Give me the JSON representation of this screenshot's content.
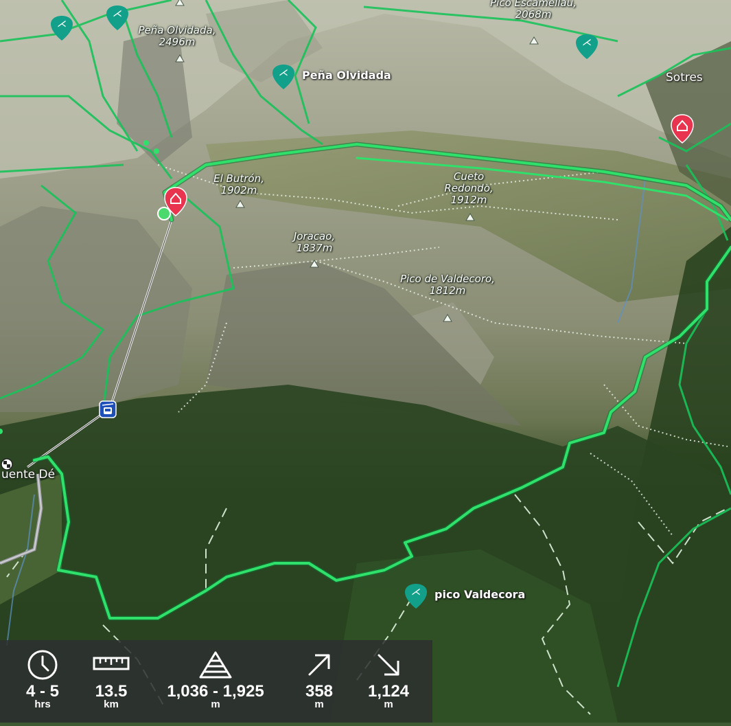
{
  "map": {
    "peaks": [
      {
        "name": "Peña Olvidada,",
        "elev": "2496m"
      },
      {
        "name": "Pico Escamellau,",
        "elev": "2068m"
      },
      {
        "name": "El Butrón,",
        "elev": "1902m"
      },
      {
        "name": "Cueto Redondo,",
        "elev": "1912m"
      },
      {
        "name": "Joracao,",
        "elev": "1837m"
      },
      {
        "name": "Pico de Valdecoro,",
        "elev": "1812m"
      }
    ],
    "pois": [
      {
        "label": "Peña Olvidada",
        "icon": "climbing-icon"
      },
      {
        "label": "pico Valdecora",
        "icon": "climbing-icon"
      }
    ],
    "places": {
      "sotres": "Sotres",
      "fuente_de": "uente Dé"
    },
    "colors": {
      "route": "#2fe06a",
      "trail": "#19c25a",
      "marker_hut": "#e8344e",
      "marker_poi": "#13a08a"
    }
  },
  "stats": [
    {
      "icon": "clock-icon",
      "value": "4 - 5",
      "unit": "hrs"
    },
    {
      "icon": "ruler-icon",
      "value": "13.5",
      "unit": "km"
    },
    {
      "icon": "elevation-icon",
      "value": "1,036 - 1,925",
      "unit": "m"
    },
    {
      "icon": "ascent-arrow-icon",
      "value": "358",
      "unit": "m"
    },
    {
      "icon": "descent-arrow-icon",
      "value": "1,124",
      "unit": "m"
    }
  ]
}
